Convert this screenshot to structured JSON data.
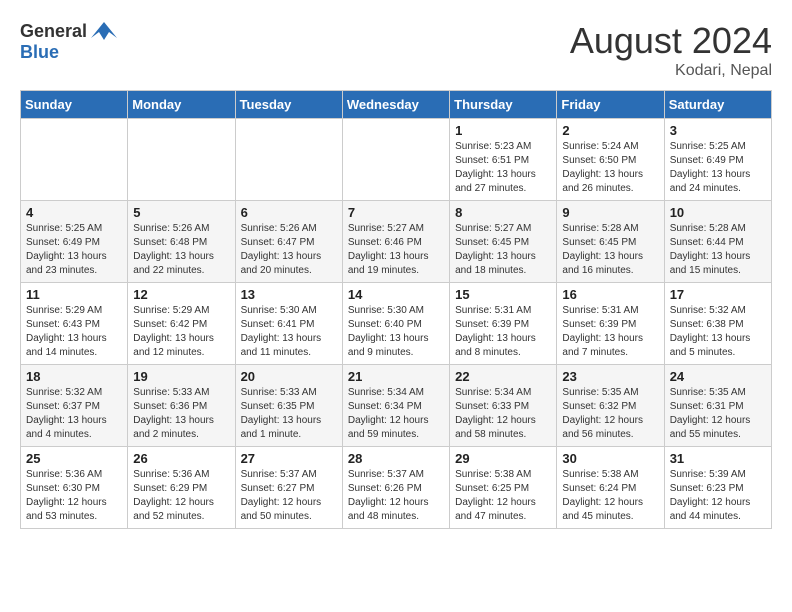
{
  "logo": {
    "general": "General",
    "blue": "Blue"
  },
  "title": "August 2024",
  "location": "Kodari, Nepal",
  "days": [
    "Sunday",
    "Monday",
    "Tuesday",
    "Wednesday",
    "Thursday",
    "Friday",
    "Saturday"
  ],
  "weeks": [
    [
      {
        "date": "",
        "info": ""
      },
      {
        "date": "",
        "info": ""
      },
      {
        "date": "",
        "info": ""
      },
      {
        "date": "",
        "info": ""
      },
      {
        "date": "1",
        "info": "Sunrise: 5:23 AM\nSunset: 6:51 PM\nDaylight: 13 hours\nand 27 minutes."
      },
      {
        "date": "2",
        "info": "Sunrise: 5:24 AM\nSunset: 6:50 PM\nDaylight: 13 hours\nand 26 minutes."
      },
      {
        "date": "3",
        "info": "Sunrise: 5:25 AM\nSunset: 6:49 PM\nDaylight: 13 hours\nand 24 minutes."
      }
    ],
    [
      {
        "date": "4",
        "info": "Sunrise: 5:25 AM\nSunset: 6:49 PM\nDaylight: 13 hours\nand 23 minutes."
      },
      {
        "date": "5",
        "info": "Sunrise: 5:26 AM\nSunset: 6:48 PM\nDaylight: 13 hours\nand 22 minutes."
      },
      {
        "date": "6",
        "info": "Sunrise: 5:26 AM\nSunset: 6:47 PM\nDaylight: 13 hours\nand 20 minutes."
      },
      {
        "date": "7",
        "info": "Sunrise: 5:27 AM\nSunset: 6:46 PM\nDaylight: 13 hours\nand 19 minutes."
      },
      {
        "date": "8",
        "info": "Sunrise: 5:27 AM\nSunset: 6:45 PM\nDaylight: 13 hours\nand 18 minutes."
      },
      {
        "date": "9",
        "info": "Sunrise: 5:28 AM\nSunset: 6:45 PM\nDaylight: 13 hours\nand 16 minutes."
      },
      {
        "date": "10",
        "info": "Sunrise: 5:28 AM\nSunset: 6:44 PM\nDaylight: 13 hours\nand 15 minutes."
      }
    ],
    [
      {
        "date": "11",
        "info": "Sunrise: 5:29 AM\nSunset: 6:43 PM\nDaylight: 13 hours\nand 14 minutes."
      },
      {
        "date": "12",
        "info": "Sunrise: 5:29 AM\nSunset: 6:42 PM\nDaylight: 13 hours\nand 12 minutes."
      },
      {
        "date": "13",
        "info": "Sunrise: 5:30 AM\nSunset: 6:41 PM\nDaylight: 13 hours\nand 11 minutes."
      },
      {
        "date": "14",
        "info": "Sunrise: 5:30 AM\nSunset: 6:40 PM\nDaylight: 13 hours\nand 9 minutes."
      },
      {
        "date": "15",
        "info": "Sunrise: 5:31 AM\nSunset: 6:39 PM\nDaylight: 13 hours\nand 8 minutes."
      },
      {
        "date": "16",
        "info": "Sunrise: 5:31 AM\nSunset: 6:39 PM\nDaylight: 13 hours\nand 7 minutes."
      },
      {
        "date": "17",
        "info": "Sunrise: 5:32 AM\nSunset: 6:38 PM\nDaylight: 13 hours\nand 5 minutes."
      }
    ],
    [
      {
        "date": "18",
        "info": "Sunrise: 5:32 AM\nSunset: 6:37 PM\nDaylight: 13 hours\nand 4 minutes."
      },
      {
        "date": "19",
        "info": "Sunrise: 5:33 AM\nSunset: 6:36 PM\nDaylight: 13 hours\nand 2 minutes."
      },
      {
        "date": "20",
        "info": "Sunrise: 5:33 AM\nSunset: 6:35 PM\nDaylight: 13 hours\nand 1 minute."
      },
      {
        "date": "21",
        "info": "Sunrise: 5:34 AM\nSunset: 6:34 PM\nDaylight: 12 hours\nand 59 minutes."
      },
      {
        "date": "22",
        "info": "Sunrise: 5:34 AM\nSunset: 6:33 PM\nDaylight: 12 hours\nand 58 minutes."
      },
      {
        "date": "23",
        "info": "Sunrise: 5:35 AM\nSunset: 6:32 PM\nDaylight: 12 hours\nand 56 minutes."
      },
      {
        "date": "24",
        "info": "Sunrise: 5:35 AM\nSunset: 6:31 PM\nDaylight: 12 hours\nand 55 minutes."
      }
    ],
    [
      {
        "date": "25",
        "info": "Sunrise: 5:36 AM\nSunset: 6:30 PM\nDaylight: 12 hours\nand 53 minutes."
      },
      {
        "date": "26",
        "info": "Sunrise: 5:36 AM\nSunset: 6:29 PM\nDaylight: 12 hours\nand 52 minutes."
      },
      {
        "date": "27",
        "info": "Sunrise: 5:37 AM\nSunset: 6:27 PM\nDaylight: 12 hours\nand 50 minutes."
      },
      {
        "date": "28",
        "info": "Sunrise: 5:37 AM\nSunset: 6:26 PM\nDaylight: 12 hours\nand 48 minutes."
      },
      {
        "date": "29",
        "info": "Sunrise: 5:38 AM\nSunset: 6:25 PM\nDaylight: 12 hours\nand 47 minutes."
      },
      {
        "date": "30",
        "info": "Sunrise: 5:38 AM\nSunset: 6:24 PM\nDaylight: 12 hours\nand 45 minutes."
      },
      {
        "date": "31",
        "info": "Sunrise: 5:39 AM\nSunset: 6:23 PM\nDaylight: 12 hours\nand 44 minutes."
      }
    ]
  ]
}
